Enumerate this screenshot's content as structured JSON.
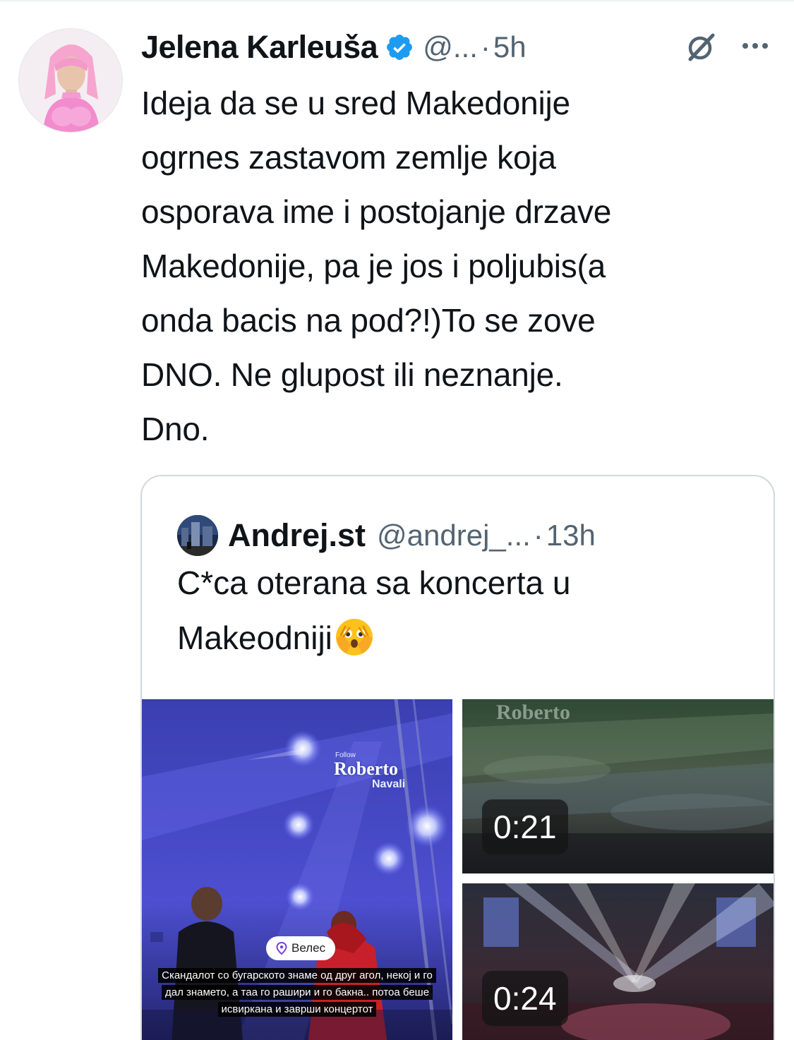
{
  "tweet": {
    "author_name": "Jelena Karleuša",
    "handle": "@...",
    "separator": "·",
    "time": "5h",
    "lines": [
      "Ideja da se u sred Makedonije",
      "ogrnes zastavom zemlje koja",
      "osporava ime i postojanje drzave",
      "Makedonije, pa je jos i poljubis(a",
      "onda bacis na pod?!)To se zove",
      "DNO. Ne glupost ili neznanje.",
      "Dno."
    ],
    "icons": {
      "verified": "verified-badge-icon",
      "grok": "grok-icon",
      "more": "more-icon"
    },
    "colors": {
      "verified": "#1d9bf0",
      "secondary_text": "#536471",
      "border": "#cfd9de"
    }
  },
  "quote": {
    "author_name": "Andrej.st",
    "handle": "@andrej_...",
    "separator": "·",
    "time": "13h",
    "lines": [
      "C*ca oterana sa koncerta u",
      "Makeodniji"
    ],
    "emoji": "face-with-open-eyes-and-hand-over-mouth",
    "media": {
      "left": {
        "watermark_follow": "Follow",
        "watermark_name": "Roberto",
        "watermark_sub": "Navali",
        "location": "Велес",
        "caption": "Скандалот со бугарското знаме од друг агол, некој и го дал знамето, а таа го рашири и го бакна.. потоа беше исвиркана и заврши концертот"
      },
      "right_top": {
        "duration": "0:21",
        "watermark": "Roberto"
      },
      "right_bottom": {
        "duration": "0:24"
      }
    }
  }
}
